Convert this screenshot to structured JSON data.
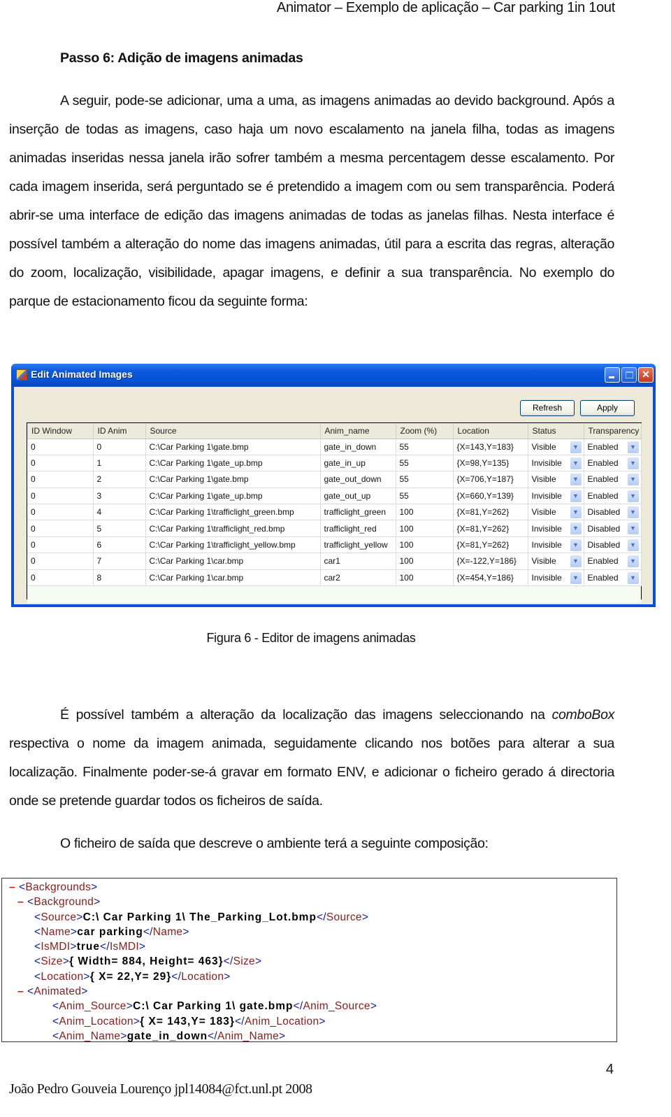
{
  "header": {
    "running_title": "Animator – Exemplo de aplicação – Car parking 1in 1out"
  },
  "section": {
    "title": "Passo 6: Adição de imagens animadas"
  },
  "paragraphs": {
    "p1": "A seguir, pode-se adicionar, uma a uma, as imagens animadas ao devido background. Após a inserção de todas as imagens, caso haja um novo escalamento na janela filha, todas as imagens animadas inseridas nessa janela irão sofrer também a mesma percentagem desse escalamento. Por cada imagem inserida, será perguntado se é pretendido a imagem com ou sem transparência. Poderá abrir-se uma interface de edição das imagens animadas de todas as janelas filhas. Nesta interface é possível também a alteração do nome das imagens animadas, útil para a escrita das regras, alteração do zoom, localização, visibilidade, apagar imagens, e definir a sua transparência. No exemplo do parque de estacionamento ficou da seguinte forma:",
    "p2_before": "É possível também a alteração da localização das imagens seleccionando na ",
    "p2_em": "comboBox",
    "p2_after": " respectiva o nome da imagem animada, seguidamente clicando nos botões para alterar a sua localização. Finalmente poder-se-á gravar em formato ENV, e adicionar o ficheiro gerado á directoria onde se pretende guardar todos os ficheiros de saída.",
    "p3": "O ficheiro de saída que descreve o ambiente terá a seguinte composição:"
  },
  "window": {
    "title": "Edit Animated Images",
    "icon": "app-icon",
    "buttons": {
      "refresh": "Refresh",
      "apply": "Apply"
    },
    "controls": {
      "minimize": "minimize-icon",
      "maximize": "maximize-icon",
      "close": "close-icon",
      "close_glyph": "✕"
    },
    "grid": {
      "columns": [
        "ID Window",
        "ID Anim",
        "Source",
        "Anim_name",
        "Zoom (%)",
        "Location",
        "Status",
        "Transparency"
      ],
      "rows": [
        [
          "0",
          "0",
          "C:\\Car Parking 1\\gate.bmp",
          "gate_in_down",
          "55",
          "{X=143,Y=183}",
          "Visible",
          "Enabled"
        ],
        [
          "0",
          "1",
          "C:\\Car Parking 1\\gate_up.bmp",
          "gate_in_up",
          "55",
          "{X=98,Y=135}",
          "Invisible",
          "Enabled"
        ],
        [
          "0",
          "2",
          "C:\\Car Parking 1\\gate.bmp",
          "gate_out_down",
          "55",
          "{X=706,Y=187}",
          "Visible",
          "Enabled"
        ],
        [
          "0",
          "3",
          "C:\\Car Parking 1\\gate_up.bmp",
          "gate_out_up",
          "55",
          "{X=660,Y=139}",
          "Invisible",
          "Enabled"
        ],
        [
          "0",
          "4",
          "C:\\Car Parking 1\\trafficlight_green.bmp",
          "trafficlight_green",
          "100",
          "{X=81,Y=262}",
          "Visible",
          "Disabled"
        ],
        [
          "0",
          "5",
          "C:\\Car Parking 1\\trafficlight_red.bmp",
          "trafficlight_red",
          "100",
          "{X=81,Y=262}",
          "Invisible",
          "Disabled"
        ],
        [
          "0",
          "6",
          "C:\\Car Parking 1\\trafficlight_yellow.bmp",
          "trafficlight_yellow",
          "100",
          "{X=81,Y=262}",
          "Invisible",
          "Disabled"
        ],
        [
          "0",
          "7",
          "C:\\Car Parking 1\\car.bmp",
          "car1",
          "100",
          "{X=-122,Y=186}",
          "Visible",
          "Enabled"
        ],
        [
          "0",
          "8",
          "C:\\Car Parking 1\\car.bmp",
          "car2",
          "100",
          "{X=454,Y=186}",
          "Invisible",
          "Enabled"
        ]
      ],
      "dropdown_glyph": "▼"
    }
  },
  "figure": {
    "caption": "Figura 6 - Editor de imagens animadas"
  },
  "xml": {
    "lines": [
      {
        "indent": 0,
        "collapse": true,
        "open": "Backgrounds"
      },
      {
        "indent": 1,
        "collapse": true,
        "open": "Background"
      },
      {
        "indent": 2,
        "open": "Source",
        "value": "C:\\ Car Parking 1\\ The_Parking_Lot.bmp",
        "close": "Source"
      },
      {
        "indent": 2,
        "open": "Name",
        "value": "car parking",
        "close": "Name"
      },
      {
        "indent": 2,
        "open": "IsMDI",
        "value": "true",
        "close": "IsMDI"
      },
      {
        "indent": 2,
        "open": "Size",
        "value": "{ Width= 884, Height= 463}",
        "close": "Size"
      },
      {
        "indent": 2,
        "open": "Location",
        "value": "{ X= 22,Y= 29}",
        "close": "Location"
      },
      {
        "indent": 1,
        "collapse": true,
        "open": "Animated"
      },
      {
        "indent": 3,
        "open": "Anim_Source",
        "value": "C:\\ Car Parking 1\\ gate.bmp",
        "close": "Anim_Source"
      },
      {
        "indent": 3,
        "open": "Anim_Location",
        "value": "{ X= 143,Y= 183}",
        "close": "Anim_Location"
      },
      {
        "indent": 3,
        "open": "Anim_Name",
        "value": "gate_in_down",
        "close": "Anim_Name"
      }
    ],
    "minus_glyph": "–"
  },
  "footer": {
    "page_number": "4",
    "author_line": "João Pedro Gouveia Lourenço jpl14084@fct.unl.pt 2008"
  }
}
